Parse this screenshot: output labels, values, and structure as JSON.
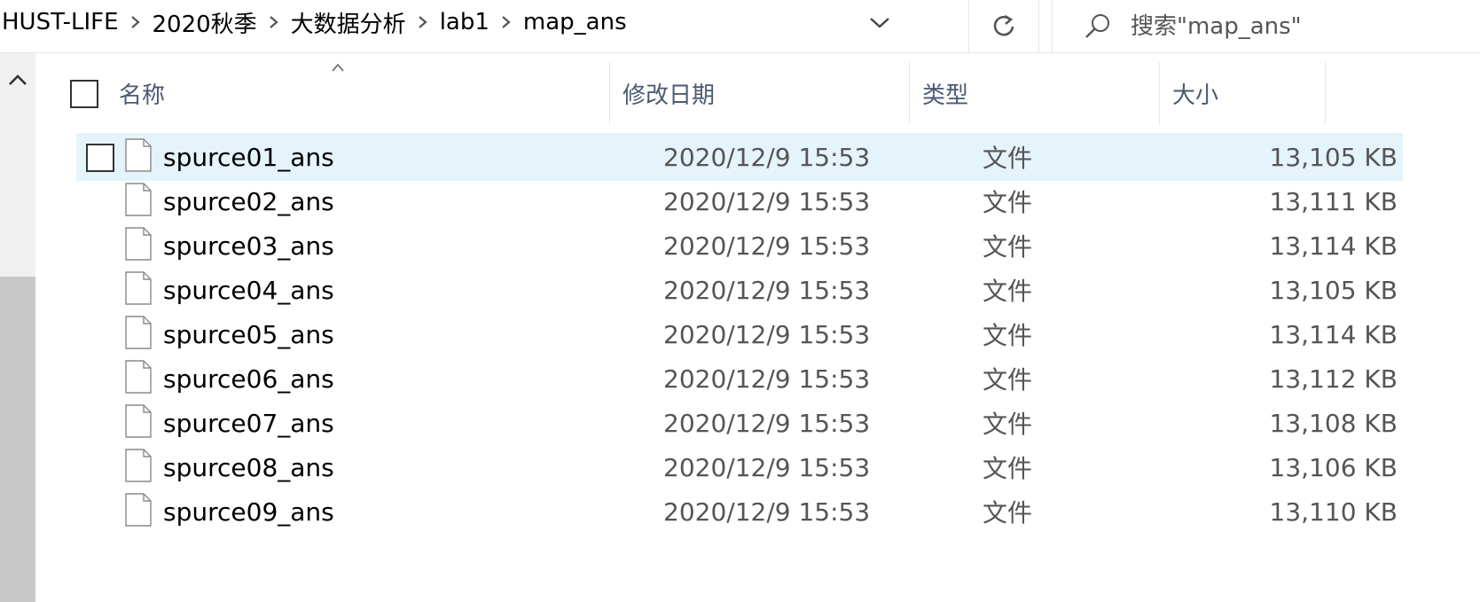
{
  "breadcrumb": [
    "HUST-LIFE",
    "2020秋季",
    "大数据分析",
    "lab1",
    "map_ans"
  ],
  "search": {
    "placeholder": "搜索\"map_ans\""
  },
  "columns": {
    "name": "名称",
    "date": "修改日期",
    "type": "类型",
    "size": "大小"
  },
  "sort": {
    "column": "name",
    "direction": "ascending"
  },
  "selected_row": 0,
  "files": [
    {
      "name": "spurce01_ans",
      "date": "2020/12/9 15:53",
      "type": "文件",
      "size": "13,105 KB"
    },
    {
      "name": "spurce02_ans",
      "date": "2020/12/9 15:53",
      "type": "文件",
      "size": "13,111 KB"
    },
    {
      "name": "spurce03_ans",
      "date": "2020/12/9 15:53",
      "type": "文件",
      "size": "13,114 KB"
    },
    {
      "name": "spurce04_ans",
      "date": "2020/12/9 15:53",
      "type": "文件",
      "size": "13,105 KB"
    },
    {
      "name": "spurce05_ans",
      "date": "2020/12/9 15:53",
      "type": "文件",
      "size": "13,114 KB"
    },
    {
      "name": "spurce06_ans",
      "date": "2020/12/9 15:53",
      "type": "文件",
      "size": "13,112 KB"
    },
    {
      "name": "spurce07_ans",
      "date": "2020/12/9 15:53",
      "type": "文件",
      "size": "13,108 KB"
    },
    {
      "name": "spurce08_ans",
      "date": "2020/12/9 15:53",
      "type": "文件",
      "size": "13,106 KB"
    },
    {
      "name": "spurce09_ans",
      "date": "2020/12/9 15:53",
      "type": "文件",
      "size": "13,110 KB"
    }
  ],
  "colors": {
    "selection": "#e5f3fb",
    "header_text": "#4a5a73",
    "secondary_text": "#555555"
  },
  "icons": [
    "chevron-right-icon",
    "chevron-down-icon",
    "refresh-icon",
    "search-icon",
    "scroll-up-icon",
    "sort-up-icon",
    "file-icon"
  ]
}
